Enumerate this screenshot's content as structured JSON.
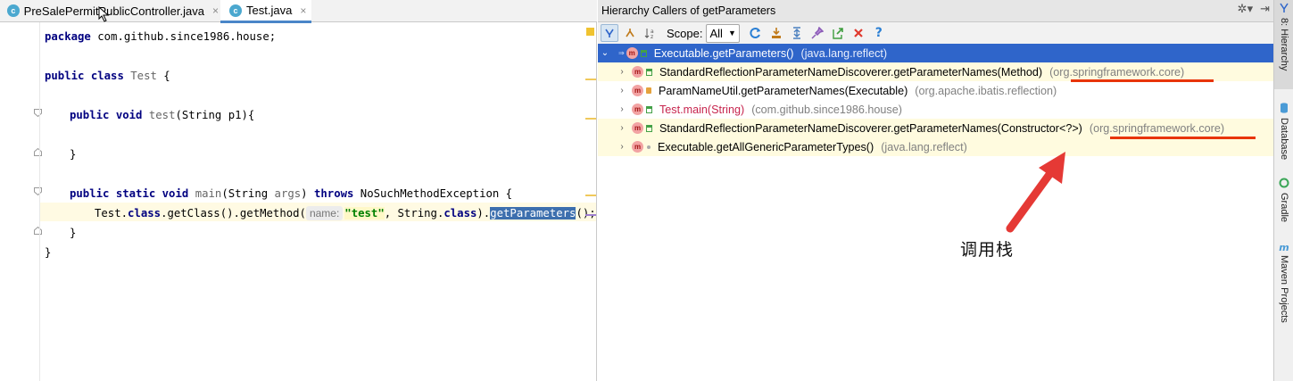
{
  "editor": {
    "tabs": [
      {
        "icon": "class-icon",
        "icon_letter": "c",
        "label": "PreSalePermitPublicController.java",
        "close": "×"
      },
      {
        "icon": "class-icon",
        "icon_letter": "c",
        "label": "Test.java",
        "close": "×"
      }
    ],
    "code": {
      "l1_kw": "package",
      "l1_rest": " com.github.since1986.house;",
      "l2_kw1": "public",
      "l2_kw2": "class",
      "l2_name": "Test",
      "l2_rest": " {",
      "l3_kw1": "public",
      "l3_kw2": "void",
      "l3_name": "test",
      "l3_rest": "(String p1){",
      "l4": "}",
      "l5_kw1": "public",
      "l5_kw2": "static",
      "l5_kw3": "void",
      "l5_name": "main",
      "l5_params": "(String ",
      "l5_arg": "args",
      "l5_close": ") ",
      "l5_throws": "throws",
      "l5_rest": " NoSuchMethodException {",
      "l6_a": "Test.",
      "l6_kw": "class",
      "l6_b": ".getClass().getMethod(",
      "l6_hint": "name:",
      "l6_str": "\"test\"",
      "l6_c": ", String.",
      "l6_kw2": "class",
      "l6_d": ").",
      "l6_sel": "getParameters",
      "l6_e": "();",
      "l7": "}",
      "l8": "}"
    }
  },
  "panel": {
    "title": "Hierarchy Callers of getParameters",
    "header_icons": [
      "gear-icon",
      "pin-icon"
    ],
    "gear": "✲▾",
    "hide": "⇥",
    "scope_label": "Scope:",
    "scope_value": "All",
    "tree": [
      {
        "method": "Executable.getParameters()",
        "package": "(java.lang.reflect)",
        "expander": "⌄",
        "selected": true
      },
      {
        "method": "StandardReflectionParameterNameDiscoverer.getParameterNames(Method)",
        "package": "(org.springframework.core)",
        "expander": "›"
      },
      {
        "method": "ParamNameUtil.getParameterNames(Executable)",
        "package": "(org.apache.ibatis.reflection)",
        "expander": "›"
      },
      {
        "method": "Test.main(String)",
        "package": "(com.github.since1986.house)",
        "expander": "›"
      },
      {
        "method": "StandardReflectionParameterNameDiscoverer.getParameterNames(Constructor<?>)",
        "package": "(org.springframework.core)",
        "expander": "›"
      },
      {
        "method": "Executable.getAllGenericParameterTypes()",
        "package": "(java.lang.reflect)",
        "expander": "›"
      }
    ],
    "annotation": "调用栈"
  },
  "tool_strip": {
    "items": [
      {
        "number": "8",
        "label": "Hierarchy"
      },
      {
        "label": "Database"
      },
      {
        "label": "Gradle"
      },
      {
        "label": "Maven Projects"
      }
    ]
  },
  "colors": {
    "selection": "#2f65ca",
    "underline": "#e8340a",
    "arrow": "#e53935"
  }
}
